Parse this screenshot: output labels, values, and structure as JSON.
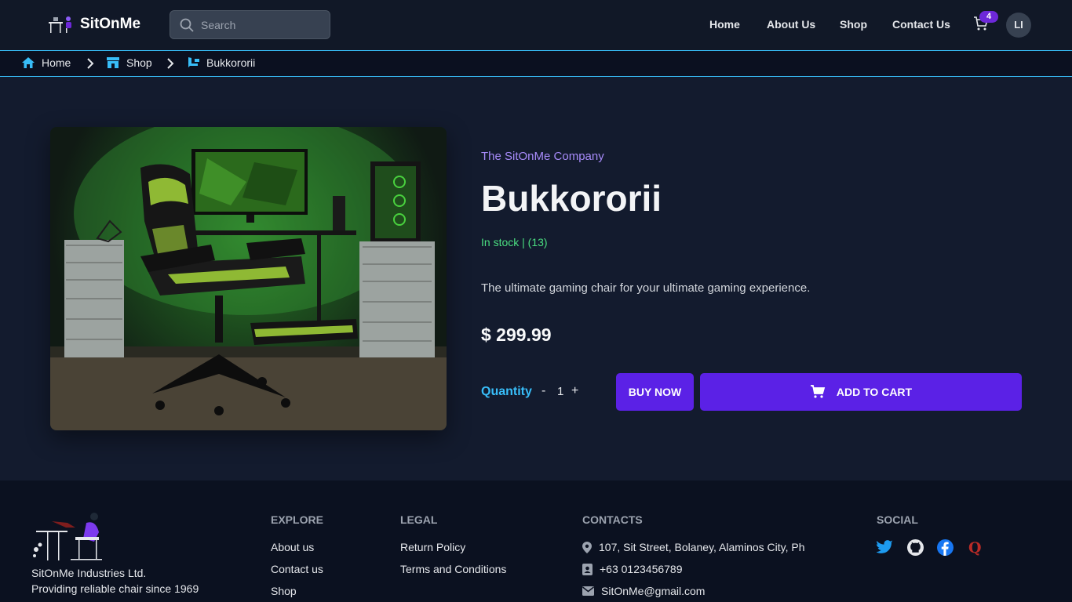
{
  "header": {
    "brand": "SitOnMe",
    "search_placeholder": "Search",
    "nav": [
      "Home",
      "About Us",
      "Shop",
      "Contact Us"
    ],
    "cart_count": "4",
    "avatar_initials": "LI"
  },
  "breadcrumb": [
    "Home",
    "Shop",
    "Bukkororii"
  ],
  "product": {
    "company": "The SitOnMe Company",
    "name": "Bukkororii",
    "stock": "In stock | (13)",
    "description": "The ultimate gaming chair for your ultimate gaming experience.",
    "price": "$ 299.99",
    "quantity_label": "Quantity",
    "quantity_minus": "-",
    "quantity_value": "1",
    "quantity_plus": "+",
    "buy_now": "BUY NOW",
    "add_to_cart": "ADD TO CART"
  },
  "footer": {
    "company": "SitOnMe Industries Ltd.",
    "tagline": "Providing reliable chair since 1969",
    "explore": {
      "heading": "EXPLORE",
      "links": [
        "About us",
        "Contact us",
        "Shop"
      ]
    },
    "legal": {
      "heading": "LEGAL",
      "links": [
        "Return Policy",
        "Terms and Conditions"
      ]
    },
    "contacts": {
      "heading": "CONTACTS",
      "address": "107, Sit Street, Bolaney, Alaminos City, Ph",
      "phone": "+63 0123456789",
      "email": "SitOnMe@gmail.com"
    },
    "social": {
      "heading": "SOCIAL",
      "icons": [
        "twitter-icon",
        "github-icon",
        "facebook-icon",
        "quora-icon"
      ]
    }
  },
  "colors": {
    "background": "#111827",
    "accent_purple": "#5b21e6",
    "breadcrumb_line": "#38bdf8",
    "stock_green": "#4ade80",
    "company_purple": "#a78bfa"
  }
}
